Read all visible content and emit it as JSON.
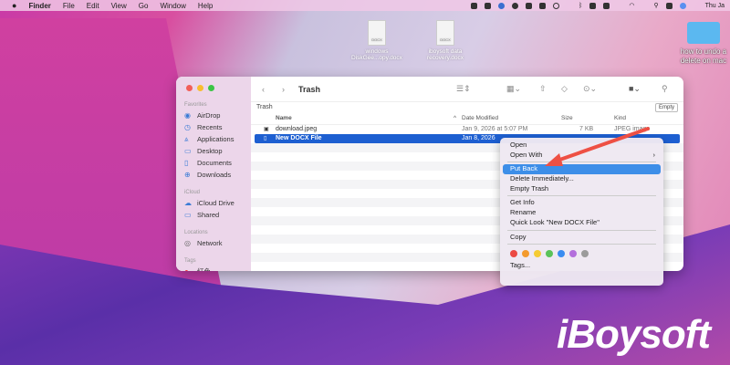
{
  "menubar": {
    "app": "Finder",
    "items": [
      "File",
      "Edit",
      "View",
      "Go",
      "Window",
      "Help"
    ],
    "clock": "Thu Ja"
  },
  "desktop": {
    "icons": [
      {
        "label1": "windows",
        "label2": "DiskGee...opy.docx",
        "badge": "DOCX"
      },
      {
        "label1": "iboysoft data",
        "label2": "recovery.docx",
        "badge": "DOCX"
      },
      {
        "label1": "how to undo a",
        "label2": "delete on mac"
      }
    ]
  },
  "window": {
    "title": "Trash",
    "path": "Trash",
    "empty_button": "Empty",
    "sidebar": {
      "favorites_label": "Favorites",
      "favorites": [
        "AirDrop",
        "Recents",
        "Applications",
        "Desktop",
        "Documents",
        "Downloads"
      ],
      "icloud_label": "iCloud",
      "icloud": [
        "iCloud Drive",
        "Shared"
      ],
      "locations_label": "Locations",
      "locations": [
        "Network"
      ],
      "tags_label": "Tags",
      "tags": [
        "红色"
      ]
    },
    "columns": {
      "name": "Name",
      "date": "Date Modified",
      "size": "Size",
      "kind": "Kind"
    },
    "files": [
      {
        "name": "download.jpeg",
        "date": "Jan 9, 2026 at 5:07 PM",
        "size": "7 KB",
        "kind": "JPEG image"
      },
      {
        "name": "New DOCX File",
        "date": "Jan 8, 2026",
        "size": "",
        "kind": ""
      }
    ]
  },
  "context_menu": {
    "items": [
      "Open",
      "Open With",
      "Put Back",
      "Delete Immediately...",
      "Empty Trash",
      "Get Info",
      "Rename",
      "Quick Look \"New DOCX File\"",
      "Copy",
      "Tags..."
    ],
    "highlighted": "Put Back",
    "tag_colors": [
      "#ec4a43",
      "#f39a2d",
      "#f5cb33",
      "#5ac259",
      "#3a8cf0",
      "#b36fdc",
      "#9b9b9b"
    ]
  },
  "watermark": "iBoysoft"
}
